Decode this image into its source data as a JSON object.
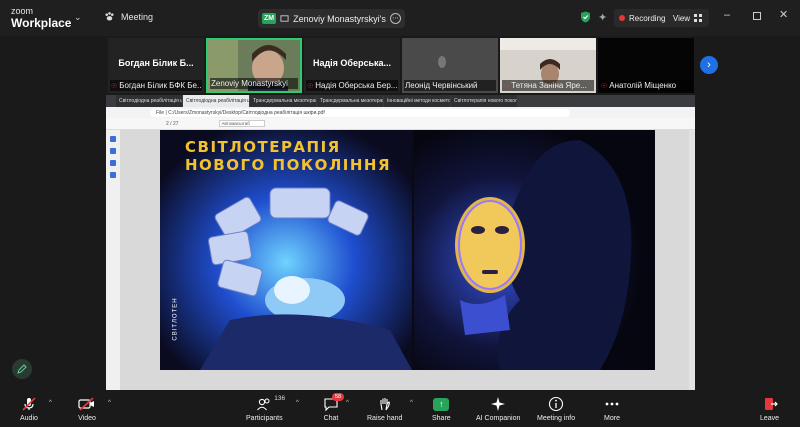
{
  "app": {
    "brand_line1": "zoom",
    "brand_line2": "Workplace"
  },
  "header": {
    "meeting_label": "Meeting",
    "share_badge": "ZM",
    "share_name": "Zenoviy Monastyrskyi's scre",
    "recording_label": "Recording",
    "view_label": "View"
  },
  "participants": [
    {
      "display": "Богдан Білик Б...",
      "caption": "Богдан Білик БФК Бе...",
      "muted": true
    },
    {
      "display": "",
      "caption": "Zenoviy Monastyrskyi",
      "muted": false,
      "active": true
    },
    {
      "display": "Надія  Оберська...",
      "caption": "Надія Оберська Бер...",
      "muted": true
    },
    {
      "display": "",
      "caption": "Леонід Червінський",
      "muted": false
    },
    {
      "display": "",
      "caption": "Тетяна  Заніна Яре...",
      "muted": true
    },
    {
      "display": "",
      "caption": "Анатолій Міщенко",
      "muted": true
    }
  ],
  "browser": {
    "tabs": [
      "Світлодіодна реабілітація шкіри обличчя",
      "Світлодіодна реабілітація шкіри",
      "Трансдермальна мезотерапія",
      "Трансдермальна мезотерапія",
      "Інноваційні методи косметології",
      "Світлотерапія нового покоління"
    ],
    "url": "File | C:/Users/Zmonastyrskyi/Desktop/Світлодіодна реабілітація шкіри.pdf",
    "page_indicator": "2 / 27",
    "zoom_label": "Автомасштаб"
  },
  "slide": {
    "title_line1": "СВІТЛОТЕРАПІЯ",
    "title_line2": "НОВОГО ПОКОЛІННЯ",
    "brand_vertical": "СВІТЛОТЕН"
  },
  "toolbar": {
    "audio": "Audio",
    "video": "Video",
    "participants": "Participants",
    "participants_count": "136",
    "chat": "Chat",
    "chat_badge": "58",
    "raise_hand": "Raise hand",
    "share": "Share",
    "ai_companion": "AI Companion",
    "meeting_info": "Meeting info",
    "more": "More",
    "leave": "Leave"
  },
  "colors": {
    "accent_green": "#27a35c",
    "record_red": "#e5383b",
    "next_blue": "#1f6fe5",
    "slide_title": "#f2c230"
  }
}
